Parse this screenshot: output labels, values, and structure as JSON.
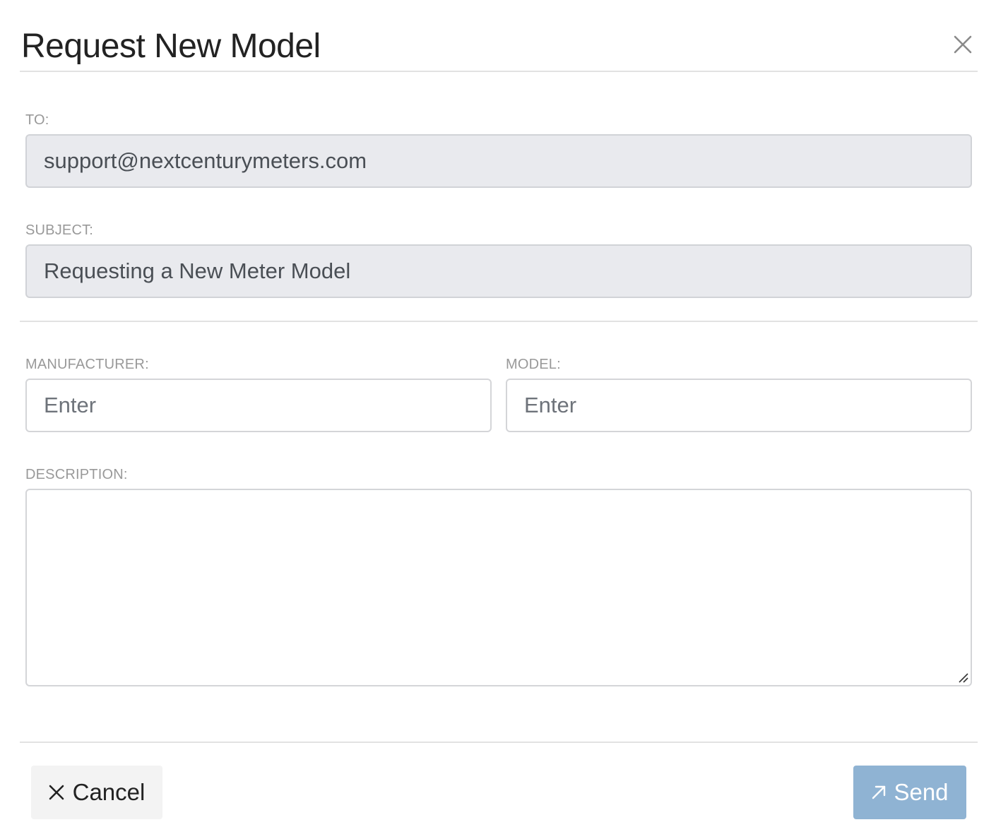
{
  "dialog": {
    "title": "Request New Model",
    "close_icon": "close-icon"
  },
  "to": {
    "label": "TO:",
    "value": "support@nextcenturymeters.com"
  },
  "subject": {
    "label": "SUBJECT:",
    "value": "Requesting a New Meter Model"
  },
  "manufacturer": {
    "label": "MANUFACTURER:",
    "placeholder": "Enter",
    "value": ""
  },
  "model": {
    "label": "MODEL:",
    "placeholder": "Enter",
    "value": ""
  },
  "description": {
    "label": "DESCRIPTION:",
    "value": ""
  },
  "footer": {
    "cancel_label": "Cancel",
    "cancel_icon": "x-icon",
    "send_label": "Send",
    "send_icon": "arrow-up-right-icon"
  },
  "colors": {
    "send_button": "#8fb3d3",
    "readonly_field": "#e9eaee",
    "cancel_button": "#f3f3f3"
  }
}
